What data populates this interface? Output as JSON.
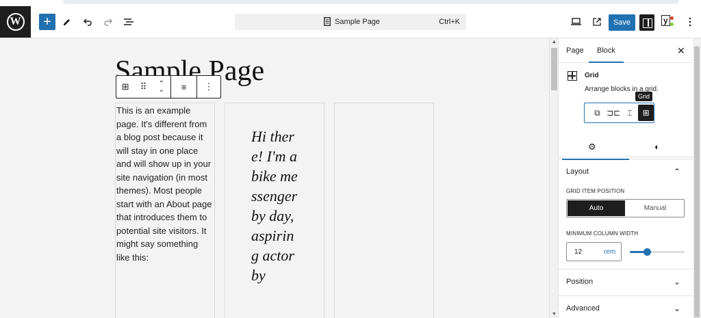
{
  "header": {
    "add_block_icon": "+",
    "tools_icon": "pencil-icon",
    "undo_icon": "undo-icon",
    "redo_icon": "redo-icon",
    "list_view_icon": "list-view-icon",
    "document_title": "Sample Page",
    "shortcut": "Ctrl+K",
    "save_label": "Save",
    "yoast_label": "y"
  },
  "canvas": {
    "page_title": "Sample Page",
    "column1_text": "This is an example page. It's different from a blog post because it will stay in one place and will show up in your site navigation (in most themes). Most people start with an About page that introduces them to potential site visitors. It might say something like this:",
    "column2_text": "Hi there! I'm a bike messenger by day, aspiring actor by"
  },
  "sidebar": {
    "tabs": [
      "Page",
      "Block"
    ],
    "close_icon": "✕",
    "block_name": "Grid",
    "block_description": "Arrange blocks in a grid.",
    "tooltip": "Grid",
    "layout_section": "Layout",
    "grid_item_position_label": "GRID ITEM POSITION",
    "position_options": [
      "Auto",
      "Manual"
    ],
    "min_column_width_label": "MINIMUM COLUMN WIDTH",
    "min_column_width_value": "12",
    "min_column_width_unit": "rem",
    "min_column_width_slider_fraction": 0.3,
    "position_section": "Position",
    "advanced_section": "Advanced"
  }
}
